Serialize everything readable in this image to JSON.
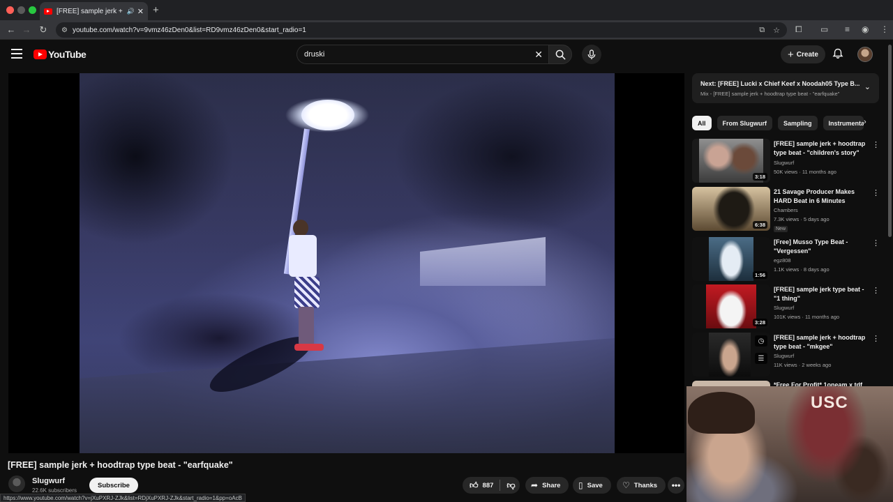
{
  "browser": {
    "tab_title": "[FREE] sample jerk + hoodtrap type beat - \"earfquake\" - YouTube",
    "url": "youtube.com/watch?v=9vmz46zDen0&list=RD9vmz46zDen0&start_radio=1",
    "status_url": "https://www.youtube.com/watch?v=jXuPXRJ-ZJk&list=RDjXuPXRJ-ZJk&start_radio=1&pp=oAcB"
  },
  "masthead": {
    "logo_text": "YouTube",
    "search_value": "druski",
    "create_label": "Create"
  },
  "video": {
    "title": "[FREE] sample jerk + hoodtrap type beat - \"earfquake\"",
    "channel": "Slugwurf",
    "subscribers": "22.6K subscribers",
    "subscribe_label": "Subscribe",
    "likes": "887",
    "share_label": "Share",
    "save_label": "Save",
    "thanks_label": "Thanks"
  },
  "sidebar": {
    "next_title": "Next: [FREE] Lucki x Chief Keef x Noodah05 Type B...",
    "next_sub": "Mix - [FREE] sample jerk + hoodtrap type beat - \"earfquake\"",
    "chips": [
      "All",
      "From Slugwurf",
      "Sampling",
      "Instrumenta"
    ],
    "recs": [
      {
        "title": "[FREE] sample jerk + hoodtrap type beat - \"children's story\"",
        "channel": "Slugwurf",
        "meta": "50K views · 11 months ago",
        "duration": "3:18",
        "badge": ""
      },
      {
        "title": "21 Savage Producer Makes HARD Beat in 6 Minutes",
        "channel": "Chambers",
        "meta": "7.3K views · 5 days ago",
        "duration": "6:38",
        "badge": "New"
      },
      {
        "title": "[Free] Musso Type Beat - \"Vergessen\"",
        "channel": "egz808",
        "meta": "1.1K views · 8 days ago",
        "duration": "1:56",
        "badge": ""
      },
      {
        "title": "[FREE] sample jerk type beat - \"1 thing\"",
        "channel": "Slugwurf",
        "meta": "101K views · 11 months ago",
        "duration": "3:28",
        "badge": ""
      },
      {
        "title": "[FREE] sample jerk + hoodtrap type beat - \"mkgee\"",
        "channel": "Slugwurf",
        "meta": "11K views · 2 weeks ago",
        "duration": "",
        "badge": ""
      },
      {
        "title": "*Free For Profit* 1oneam x tdf",
        "channel": "",
        "meta": "",
        "duration": "",
        "badge": ""
      }
    ]
  },
  "overlay": {
    "webcam_text": "USC"
  },
  "colors": {
    "accent_red": "#ff0000",
    "background": "#0f0f0f",
    "chip_bg": "#272727"
  }
}
